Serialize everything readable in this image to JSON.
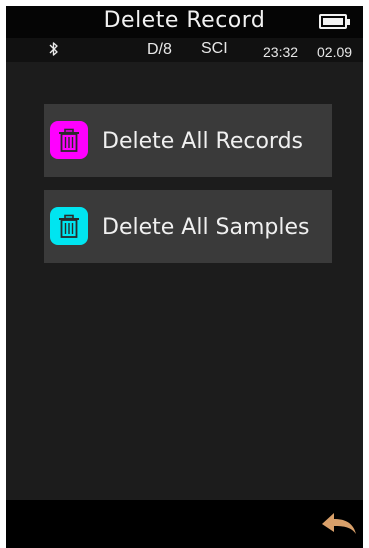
{
  "header": {
    "title": "Delete Record",
    "battery_icon": "battery-full-icon"
  },
  "status": {
    "bluetooth_icon": "bluetooth-icon",
    "geometry": "D/8",
    "mode": "SCI",
    "time": "23:32",
    "date": "02.09"
  },
  "menu": {
    "items": [
      {
        "label": "Delete All Records",
        "icon": "trash-icon",
        "icon_color": "#ff00ff"
      },
      {
        "label": "Delete All Samples",
        "icon": "trash-icon",
        "icon_color": "#00e5f0"
      }
    ]
  },
  "footer": {
    "back_icon": "back-arrow-icon",
    "back_color": "#d9a06a"
  },
  "colors": {
    "background": "#1c1c1c",
    "button": "#3a3a3a",
    "accent": "#2fd3d3"
  }
}
